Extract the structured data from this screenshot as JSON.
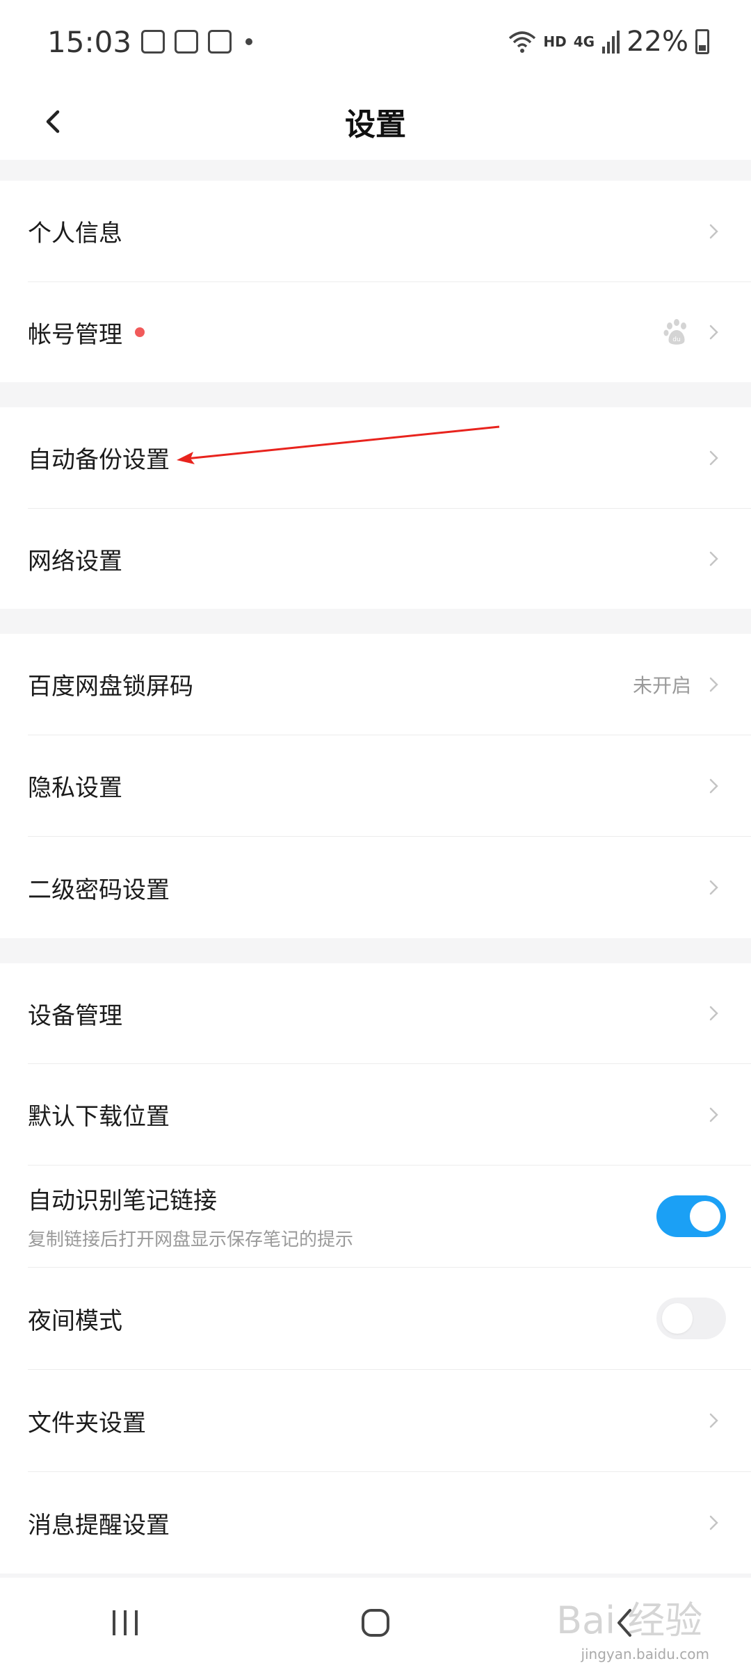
{
  "status_bar": {
    "time": "15:03",
    "network": "HD",
    "signal": "4G",
    "battery": "22%"
  },
  "header": {
    "title": "设置"
  },
  "groups": [
    {
      "items": [
        {
          "label": "个人信息"
        },
        {
          "label": "帐号管理",
          "badge": "red-dot",
          "icon": "baidu-paw-icon"
        }
      ]
    },
    {
      "items": [
        {
          "label": "自动备份设置"
        },
        {
          "label": "网络设置"
        }
      ]
    },
    {
      "items": [
        {
          "label": "百度网盘锁屏码",
          "value": "未开启"
        },
        {
          "label": "隐私设置"
        },
        {
          "label": "二级密码设置"
        }
      ]
    },
    {
      "items": [
        {
          "label": "设备管理"
        },
        {
          "label": "默认下载位置"
        },
        {
          "label": "自动识别笔记链接",
          "sublabel": "复制链接后打开网盘显示保存笔记的提示",
          "toggle": "on"
        },
        {
          "label": "夜间模式",
          "toggle": "off"
        },
        {
          "label": "文件夹设置"
        },
        {
          "label": "消息提醒设置"
        }
      ]
    }
  ],
  "watermark": {
    "text": "jingyan.baidu.com",
    "logo_text": "Bai 经验"
  },
  "colors": {
    "accent": "#1ba0f5",
    "badge": "#f15a5a",
    "annotation": "#e8231d",
    "section_gap": "#f5f5f6"
  }
}
